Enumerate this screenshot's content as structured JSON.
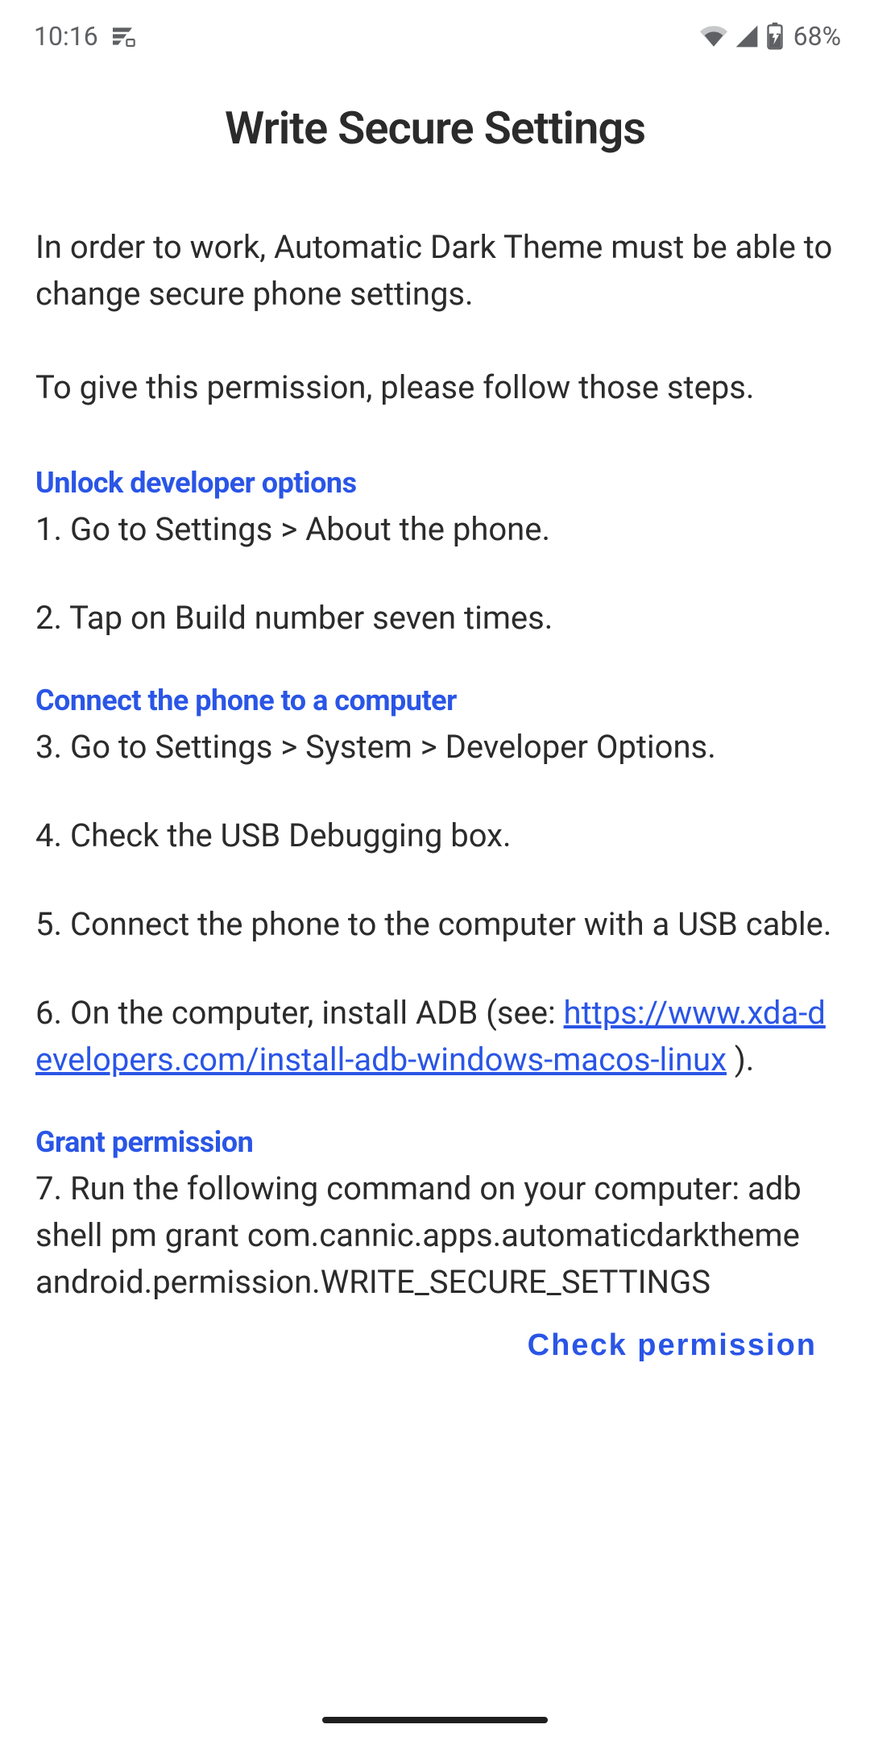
{
  "status": {
    "time": "10:16",
    "battery": "68%"
  },
  "page": {
    "title": "Write Secure Settings",
    "intro1": "In order to work, Automatic Dark Theme must be able to change secure phone settings.",
    "intro2": "To give this permission, please follow those steps."
  },
  "section1": {
    "heading": "Unlock developer options",
    "step1": "1. Go to Settings > About the phone.",
    "step2": "2. Tap on Build number seven times."
  },
  "section2": {
    "heading": "Connect the phone to a computer",
    "step3": "3. Go to Settings > System > Developer Options.",
    "step4": "4. Check the USB Debugging box.",
    "step5": "5. Connect the phone to the computer with a USB cable.",
    "step6_prefix": "6. On the computer, install ADB (see: ",
    "step6_link": "https://www.xda-developers.com/install-adb-windows-macos-linux",
    "step6_suffix": " )."
  },
  "section3": {
    "heading": "Grant permission",
    "step7": "7. Run the following command on your computer: adb shell pm grant com.cannic.apps.automaticdarktheme android.permission.WRITE_SECURE_SETTINGS"
  },
  "button": {
    "check": "Check permission"
  }
}
